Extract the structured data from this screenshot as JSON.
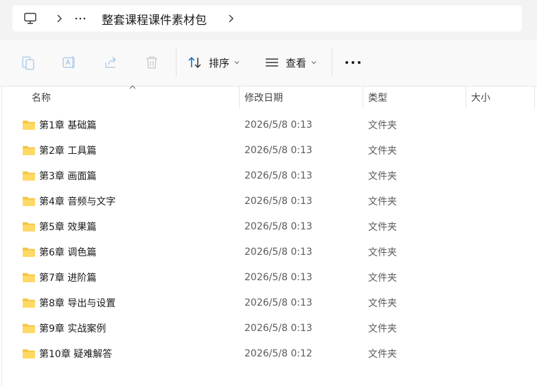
{
  "address": {
    "pc_icon": "computer-icon",
    "more_icon": "ellipsis-icon",
    "current_folder": "整套课程课件素材包"
  },
  "toolbar": {
    "copy_icon": "copy-icon",
    "rename_icon": "rename-icon",
    "share_icon": "share-icon",
    "delete_icon": "trash-icon",
    "sort_label": "排序",
    "view_label": "查看",
    "more_icon": "more-dots-icon"
  },
  "columns": {
    "name": "名称",
    "date": "修改日期",
    "type": "类型",
    "size": "大小"
  },
  "colors": {
    "folder": "#f4c542",
    "accent": "#0067c0"
  },
  "files": [
    {
      "name": "第1章 基础篇",
      "date": "2026/5/8 0:13",
      "type": "文件夹"
    },
    {
      "name": "第2章 工具篇",
      "date": "2026/5/8 0:13",
      "type": "文件夹"
    },
    {
      "name": "第3章 画面篇",
      "date": "2026/5/8 0:13",
      "type": "文件夹"
    },
    {
      "name": "第4章 音频与文字",
      "date": "2026/5/8 0:13",
      "type": "文件夹"
    },
    {
      "name": "第5章 效果篇",
      "date": "2026/5/8 0:13",
      "type": "文件夹"
    },
    {
      "name": "第6章 调色篇",
      "date": "2026/5/8 0:13",
      "type": "文件夹"
    },
    {
      "name": "第7章 进阶篇",
      "date": "2026/5/8 0:13",
      "type": "文件夹"
    },
    {
      "name": "第8章 导出与设置",
      "date": "2026/5/8 0:13",
      "type": "文件夹"
    },
    {
      "name": "第9章 实战案例",
      "date": "2026/5/8 0:13",
      "type": "文件夹"
    },
    {
      "name": "第10章 疑难解答",
      "date": "2026/5/8 0:12",
      "type": "文件夹"
    }
  ]
}
